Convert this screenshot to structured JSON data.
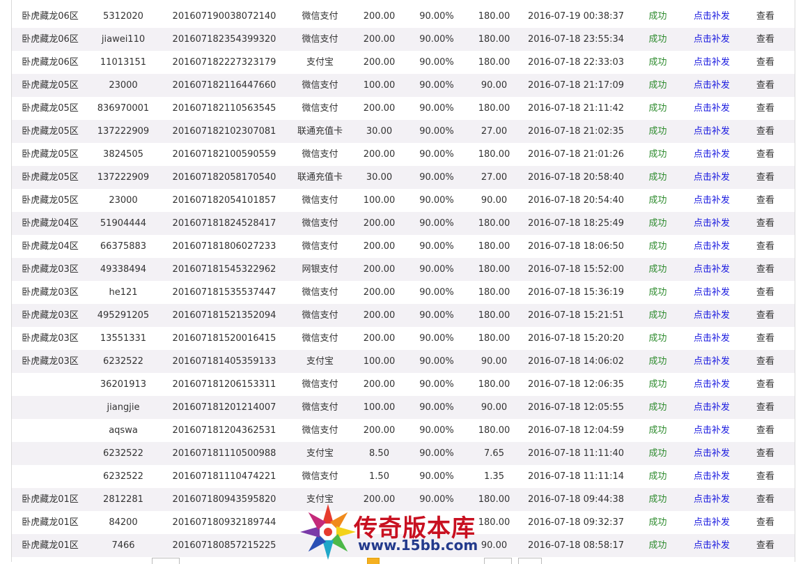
{
  "colors": {
    "success": "#2e8b2e",
    "link": "#1a1adf",
    "row_alt": "#f3f1f5",
    "watermark_title": "#c81020",
    "watermark_url": "#233a8c"
  },
  "rows": [
    {
      "zone": "卧虎藏龙06区",
      "account": "5312020",
      "order_no": "201607190038072140",
      "method": "微信支付",
      "amount": "200.00",
      "rate": "90.00%",
      "credited": "180.00",
      "time": "2016-07-19 00:38:37",
      "status": "成功",
      "reissue": "点击补发",
      "view": "查看"
    },
    {
      "zone": "卧虎藏龙06区",
      "account": "jiawei110",
      "order_no": "201607182354399320",
      "method": "微信支付",
      "amount": "200.00",
      "rate": "90.00%",
      "credited": "180.00",
      "time": "2016-07-18 23:55:34",
      "status": "成功",
      "reissue": "点击补发",
      "view": "查看"
    },
    {
      "zone": "卧虎藏龙06区",
      "account": "11013151",
      "order_no": "201607182227323179",
      "method": "支付宝",
      "amount": "200.00",
      "rate": "90.00%",
      "credited": "180.00",
      "time": "2016-07-18 22:33:03",
      "status": "成功",
      "reissue": "点击补发",
      "view": "查看"
    },
    {
      "zone": "卧虎藏龙05区",
      "account": "23000",
      "order_no": "201607182116447660",
      "method": "微信支付",
      "amount": "100.00",
      "rate": "90.00%",
      "credited": "90.00",
      "time": "2016-07-18 21:17:09",
      "status": "成功",
      "reissue": "点击补发",
      "view": "查看"
    },
    {
      "zone": "卧虎藏龙05区",
      "account": "836970001",
      "order_no": "201607182110563545",
      "method": "微信支付",
      "amount": "200.00",
      "rate": "90.00%",
      "credited": "180.00",
      "time": "2016-07-18 21:11:42",
      "status": "成功",
      "reissue": "点击补发",
      "view": "查看"
    },
    {
      "zone": "卧虎藏龙05区",
      "account": "137222909",
      "order_no": "201607182102307081",
      "method": "联通充值卡",
      "amount": "30.00",
      "rate": "90.00%",
      "credited": "27.00",
      "time": "2016-07-18 21:02:35",
      "status": "成功",
      "reissue": "点击补发",
      "view": "查看"
    },
    {
      "zone": "卧虎藏龙05区",
      "account": "3824505",
      "order_no": "201607182100590559",
      "method": "微信支付",
      "amount": "200.00",
      "rate": "90.00%",
      "credited": "180.00",
      "time": "2016-07-18 21:01:26",
      "status": "成功",
      "reissue": "点击补发",
      "view": "查看"
    },
    {
      "zone": "卧虎藏龙05区",
      "account": "137222909",
      "order_no": "201607182058170540",
      "method": "联通充值卡",
      "amount": "30.00",
      "rate": "90.00%",
      "credited": "27.00",
      "time": "2016-07-18 20:58:40",
      "status": "成功",
      "reissue": "点击补发",
      "view": "查看"
    },
    {
      "zone": "卧虎藏龙05区",
      "account": "23000",
      "order_no": "201607182054101857",
      "method": "微信支付",
      "amount": "100.00",
      "rate": "90.00%",
      "credited": "90.00",
      "time": "2016-07-18 20:54:40",
      "status": "成功",
      "reissue": "点击补发",
      "view": "查看"
    },
    {
      "zone": "卧虎藏龙04区",
      "account": "51904444",
      "order_no": "201607181824528417",
      "method": "微信支付",
      "amount": "200.00",
      "rate": "90.00%",
      "credited": "180.00",
      "time": "2016-07-18 18:25:49",
      "status": "成功",
      "reissue": "点击补发",
      "view": "查看"
    },
    {
      "zone": "卧虎藏龙04区",
      "account": "66375883",
      "order_no": "201607181806027233",
      "method": "微信支付",
      "amount": "200.00",
      "rate": "90.00%",
      "credited": "180.00",
      "time": "2016-07-18 18:06:50",
      "status": "成功",
      "reissue": "点击补发",
      "view": "查看"
    },
    {
      "zone": "卧虎藏龙03区",
      "account": "49338494",
      "order_no": "201607181545322962",
      "method": "网银支付",
      "amount": "200.00",
      "rate": "90.00%",
      "credited": "180.00",
      "time": "2016-07-18 15:52:00",
      "status": "成功",
      "reissue": "点击补发",
      "view": "查看"
    },
    {
      "zone": "卧虎藏龙03区",
      "account": "he121",
      "order_no": "201607181535537447",
      "method": "微信支付",
      "amount": "200.00",
      "rate": "90.00%",
      "credited": "180.00",
      "time": "2016-07-18 15:36:19",
      "status": "成功",
      "reissue": "点击补发",
      "view": "查看"
    },
    {
      "zone": "卧虎藏龙03区",
      "account": "495291205",
      "order_no": "201607181521352094",
      "method": "微信支付",
      "amount": "200.00",
      "rate": "90.00%",
      "credited": "180.00",
      "time": "2016-07-18 15:21:51",
      "status": "成功",
      "reissue": "点击补发",
      "view": "查看"
    },
    {
      "zone": "卧虎藏龙03区",
      "account": "13551331",
      "order_no": "201607181520016415",
      "method": "微信支付",
      "amount": "200.00",
      "rate": "90.00%",
      "credited": "180.00",
      "time": "2016-07-18 15:20:20",
      "status": "成功",
      "reissue": "点击补发",
      "view": "查看"
    },
    {
      "zone": "卧虎藏龙03区",
      "account": "6232522",
      "order_no": "201607181405359133",
      "method": "支付宝",
      "amount": "100.00",
      "rate": "90.00%",
      "credited": "90.00",
      "time": "2016-07-18 14:06:02",
      "status": "成功",
      "reissue": "点击补发",
      "view": "查看"
    },
    {
      "zone": "",
      "account": "36201913",
      "order_no": "201607181206153311",
      "method": "微信支付",
      "amount": "200.00",
      "rate": "90.00%",
      "credited": "180.00",
      "time": "2016-07-18 12:06:35",
      "status": "成功",
      "reissue": "点击补发",
      "view": "查看"
    },
    {
      "zone": "",
      "account": "jiangjie",
      "order_no": "201607181201214007",
      "method": "微信支付",
      "amount": "100.00",
      "rate": "90.00%",
      "credited": "90.00",
      "time": "2016-07-18 12:05:55",
      "status": "成功",
      "reissue": "点击补发",
      "view": "查看"
    },
    {
      "zone": "",
      "account": "aqswa",
      "order_no": "201607181204362531",
      "method": "微信支付",
      "amount": "200.00",
      "rate": "90.00%",
      "credited": "180.00",
      "time": "2016-07-18 12:04:59",
      "status": "成功",
      "reissue": "点击补发",
      "view": "查看"
    },
    {
      "zone": "",
      "account": "6232522",
      "order_no": "201607181110500988",
      "method": "支付宝",
      "amount": "8.50",
      "rate": "90.00%",
      "credited": "7.65",
      "time": "2016-07-18 11:11:40",
      "status": "成功",
      "reissue": "点击补发",
      "view": "查看"
    },
    {
      "zone": "",
      "account": "6232522",
      "order_no": "201607181110474221",
      "method": "微信支付",
      "amount": "1.50",
      "rate": "90.00%",
      "credited": "1.35",
      "time": "2016-07-18 11:11:14",
      "status": "成功",
      "reissue": "点击补发",
      "view": "查看"
    },
    {
      "zone": "卧虎藏龙01区",
      "account": "2812281",
      "order_no": "201607180943595820",
      "method": "支付宝",
      "amount": "200.00",
      "rate": "90.00%",
      "credited": "180.00",
      "time": "2016-07-18 09:44:38",
      "status": "成功",
      "reissue": "点击补发",
      "view": "查看"
    },
    {
      "zone": "卧虎藏龙01区",
      "account": "84200",
      "order_no": "201607180932189744",
      "method": "",
      "amount": "",
      "rate": "",
      "credited": "180.00",
      "time": "2016-07-18 09:32:37",
      "status": "成功",
      "reissue": "点击补发",
      "view": "查看"
    },
    {
      "zone": "卧虎藏龙01区",
      "account": "7466",
      "order_no": "201607180857215225",
      "method": "",
      "amount": "",
      "rate": "",
      "credited": "90.00",
      "time": "2016-07-18 08:58:17",
      "status": "成功",
      "reissue": "点击补发",
      "view": "查看"
    }
  ],
  "watermark": {
    "title": "传奇版本库",
    "url": "www.15bb.com"
  }
}
